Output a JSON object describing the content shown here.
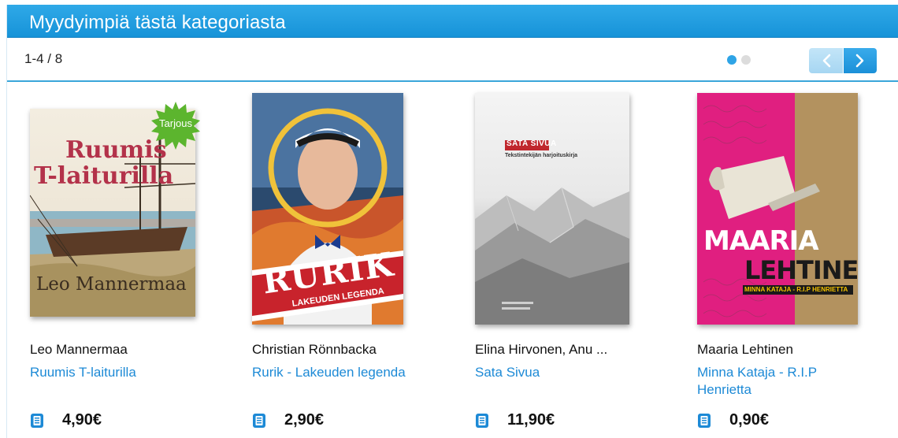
{
  "header": {
    "title": "Myydyimpiä tästä kategoriasta"
  },
  "pager": {
    "text": "1-4 / 8",
    "pages_total": 2,
    "active_page": 1,
    "prev_icon": "chevron-left-icon",
    "next_icon": "chevron-right-icon"
  },
  "colors": {
    "accent": "#1d8ad6",
    "header": "#1b96da",
    "offer_badge": "#5cb52e"
  },
  "books": [
    {
      "author": "Leo Mannermaa",
      "title": "Ruumis T-laiturilla",
      "price": "4,90€",
      "format_icon": "ebook-document-icon",
      "badge": "Tarjous",
      "cover_lines": [
        "Ruumis",
        "T-laiturilla"
      ],
      "cover_author": "Leo Mannermaa"
    },
    {
      "author": "Christian Rönnbacka",
      "title": "Rurik - Lakeuden legenda",
      "price": "2,90€",
      "format_icon": "ebook-document-icon",
      "cover_lines": [
        "RURIK",
        "LAKEUDEN LEGENDA"
      ]
    },
    {
      "author": "Elina Hirvonen, Anu ...",
      "title": "Sata Sivua",
      "price": "11,90€",
      "format_icon": "ebook-document-icon",
      "cover_lines": [
        "SATA SIVUA",
        "Tekstintekijän harjoituskirja"
      ]
    },
    {
      "author": "Maaria Lehtinen",
      "title": "Minna Kataja - R.I.P Henrietta",
      "price": "0,90€",
      "format_icon": "ebook-document-icon",
      "cover_lines": [
        "MAARIA",
        "LEHTINEN",
        "MINNA KATAJA - R.I.P HENRIETTA"
      ]
    }
  ]
}
